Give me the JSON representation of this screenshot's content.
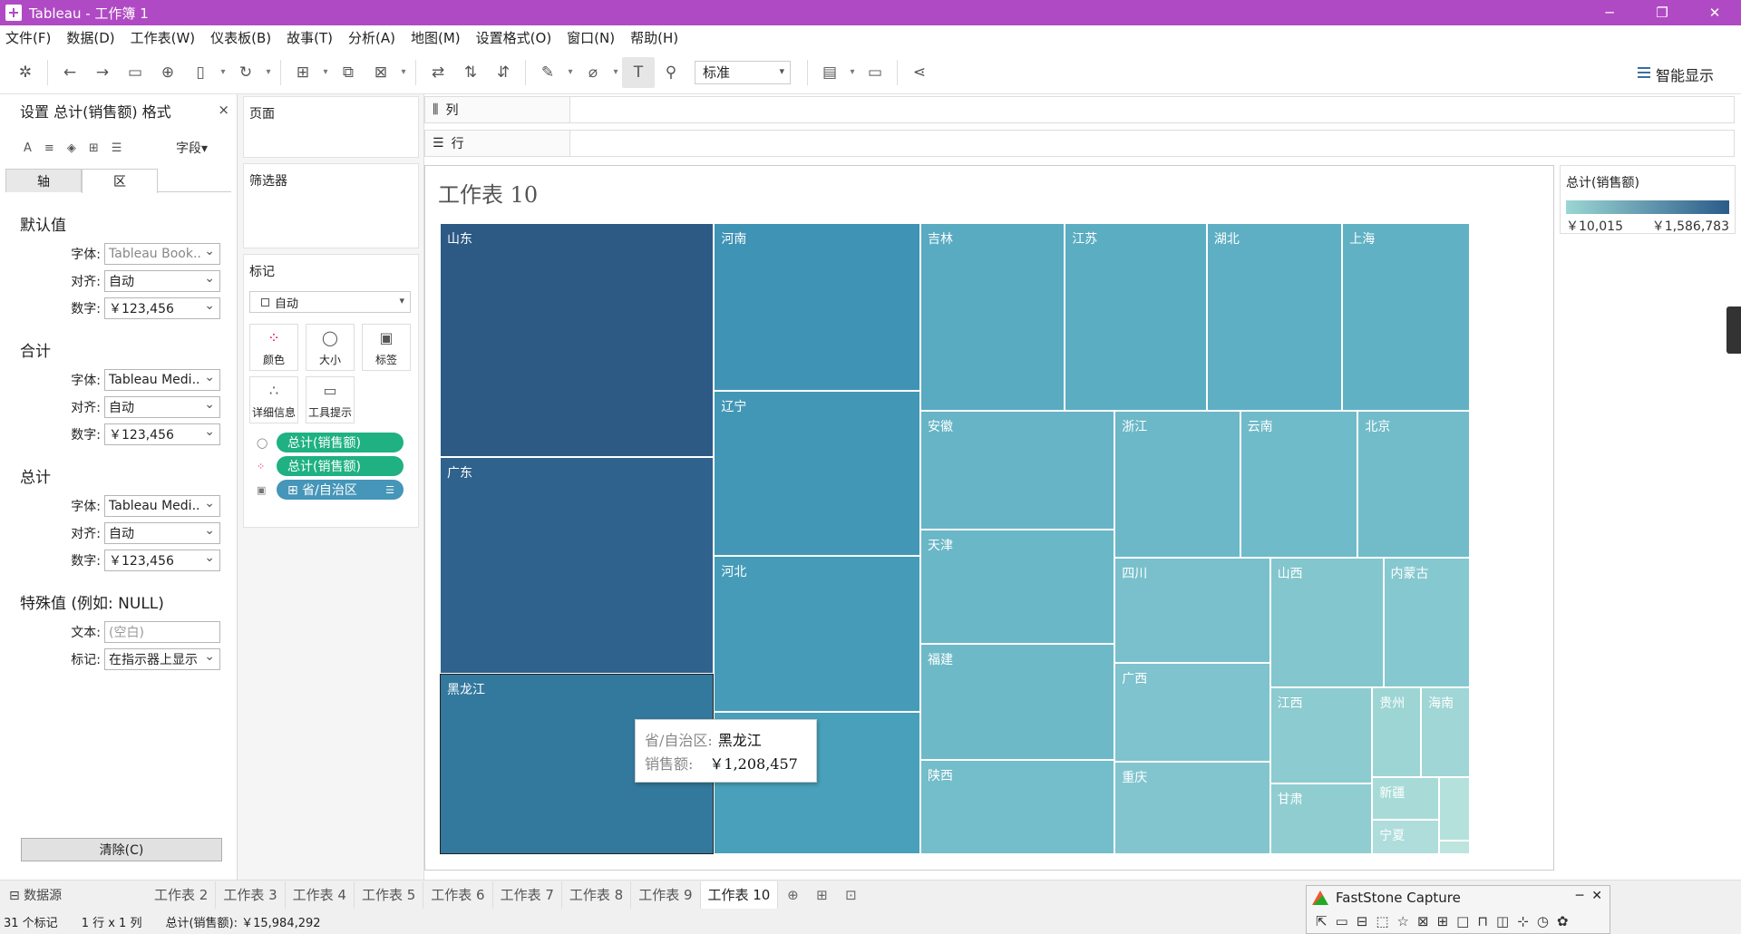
{
  "window": {
    "title": "Tableau - 工作簿 1",
    "min": "─",
    "restore": "❐",
    "close": "✕"
  },
  "menu": [
    "文件(F)",
    "数据(D)",
    "工作表(W)",
    "仪表板(B)",
    "故事(T)",
    "分析(A)",
    "地图(M)",
    "设置格式(O)",
    "窗口(N)",
    "帮助(H)"
  ],
  "toolbar": {
    "fit_value": "标准",
    "show_me": "智能显示"
  },
  "format_pane": {
    "title": "设置 总计(销售额) 格式",
    "close": "×",
    "fields_label": "字段▾",
    "tabs": [
      "轴",
      "区"
    ],
    "active_tab": "区",
    "sections": [
      {
        "title": "默认值",
        "rows": [
          {
            "label": "字体:",
            "value": "Tableau Book.."
          },
          {
            "label": "对齐:",
            "value": "自动"
          },
          {
            "label": "数字:",
            "value": "￥123,456"
          }
        ]
      },
      {
        "title": "合计",
        "rows": [
          {
            "label": "字体:",
            "value": "Tableau Medi.."
          },
          {
            "label": "对齐:",
            "value": "自动"
          },
          {
            "label": "数字:",
            "value": "￥123,456"
          }
        ]
      },
      {
        "title": "总计",
        "rows": [
          {
            "label": "字体:",
            "value": "Tableau Medi.."
          },
          {
            "label": "对齐:",
            "value": "自动"
          },
          {
            "label": "数字:",
            "value": "￥123,456"
          }
        ]
      }
    ],
    "special": {
      "title": "特殊值 (例如: NULL)",
      "text_label": "文本:",
      "text_placeholder": "(空白)",
      "mark_label": "标记:",
      "mark_value": "在指示器上显示"
    },
    "clear_button": "清除(C)"
  },
  "cards": {
    "pages": "页面",
    "filters": "筛选器",
    "marks": "标记",
    "mark_type": "自动",
    "buttons": {
      "color": "颜色",
      "size": "大小",
      "label": "标签",
      "detail": "详细信息",
      "tooltip": "工具提示"
    },
    "pills": [
      "总计(销售额)",
      "总计(销售额)",
      "⊞ 省/自治区"
    ]
  },
  "shelves": {
    "columns": "列",
    "rows": "行"
  },
  "sheet": {
    "title": "工作表 10"
  },
  "chart_data": {
    "type": "treemap",
    "measure": "总计(销售额)",
    "dimension": "省/自治区",
    "items": [
      {
        "name": "山东"
      },
      {
        "name": "广东"
      },
      {
        "name": "黑龙江",
        "value": 1208457
      },
      {
        "name": "河南"
      },
      {
        "name": "辽宁"
      },
      {
        "name": "河北"
      },
      {
        "name": "吉林"
      },
      {
        "name": "江苏"
      },
      {
        "name": "湖北"
      },
      {
        "name": "上海"
      },
      {
        "name": "安徽"
      },
      {
        "name": "浙江"
      },
      {
        "name": "云南"
      },
      {
        "name": "北京"
      },
      {
        "name": "天津"
      },
      {
        "name": "四川"
      },
      {
        "name": "山西"
      },
      {
        "name": "内蒙古"
      },
      {
        "name": "福建"
      },
      {
        "name": "广西"
      },
      {
        "name": "江西"
      },
      {
        "name": "贵州"
      },
      {
        "name": "海南"
      },
      {
        "name": "陕西"
      },
      {
        "name": "重庆"
      },
      {
        "name": "甘肃"
      },
      {
        "name": "新疆"
      },
      {
        "name": "宁夏"
      }
    ],
    "color_range": {
      "min_label": "￥10,015",
      "max_label": "￥1,586,783",
      "low_color": "#9bd6d3",
      "high_color": "#2b5b8a"
    }
  },
  "tooltip": {
    "key1": "省/自治区:",
    "val1": "黑龙江",
    "key2": "销售额:",
    "val2": "￥1,208,457"
  },
  "legend": {
    "title": "总计(销售额)",
    "min": "￥10,015",
    "max": "￥1,586,783"
  },
  "tabs": {
    "datasource": "⊟ 数据源",
    "sheets": [
      "工作表 2",
      "工作表 3",
      "工作表 4",
      "工作表 5",
      "工作表 6",
      "工作表 7",
      "工作表 8",
      "工作表 9",
      "工作表 10"
    ],
    "active": "工作表 10"
  },
  "status": {
    "marks": "31 个标记",
    "dims": "1 行 x 1 列",
    "sum": "总计(销售额): ￥15,984,292"
  },
  "faststone": {
    "title": "FastStone Capture",
    "min": "─",
    "close": "✕"
  }
}
